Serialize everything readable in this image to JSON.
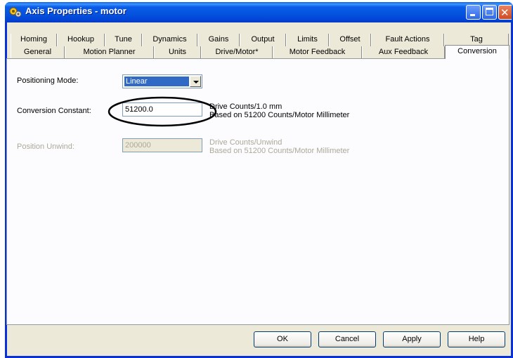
{
  "window": {
    "title": "Axis Properties - motor",
    "icon": "axis-gear-icon",
    "buttons": [
      "minimize-icon",
      "maximize-icon",
      "close-icon"
    ]
  },
  "tabs": {
    "back_row": [
      "Homing",
      "Hookup",
      "Tune",
      "Dynamics",
      "Gains",
      "Output",
      "Limits",
      "Offset",
      "Fault Actions",
      "Tag"
    ],
    "front_row": [
      "General",
      "Motion Planner",
      "Units",
      "Drive/Motor*",
      "Motor Feedback",
      "Aux Feedback",
      "Conversion"
    ],
    "active": "Conversion"
  },
  "form": {
    "positioning_mode_label": "Positioning Mode:",
    "positioning_mode_value": "Linear",
    "conversion_constant_label": "Conversion Constant:",
    "conversion_constant_value": "51200.0",
    "conversion_units_line1": "Drive Counts/1.0 mm",
    "conversion_units_line2": "Based on 51200 Counts/Motor Millimeter",
    "position_unwind_label": "Position Unwind:",
    "position_unwind_value": "200000",
    "unwind_units_line1": "Drive Counts/Unwind",
    "unwind_units_line2": "Based on 51200 Counts/Motor Millimeter"
  },
  "footer": {
    "ok": "OK",
    "cancel": "Cancel",
    "apply": "Apply",
    "help": "Help"
  }
}
